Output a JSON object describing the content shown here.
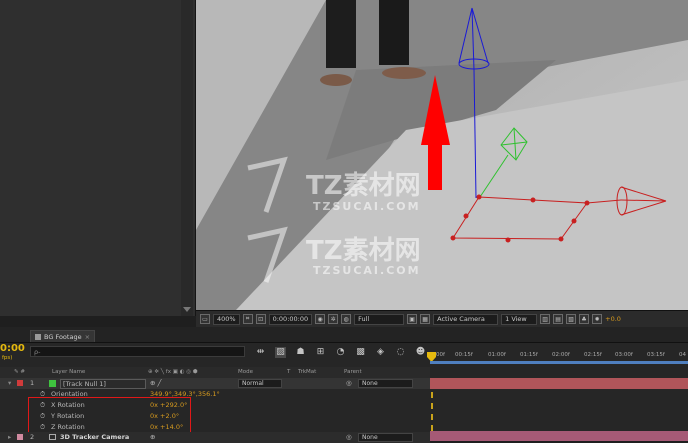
{
  "viewer": {
    "zoom": "400%",
    "timecode": "0:00:00:00",
    "resolution": "Full",
    "view": "Active Camera",
    "layout": "1 View",
    "exposure": "+0.0"
  },
  "watermark": {
    "brand": "TZ素材网",
    "url": "TZSUCAI.COM"
  },
  "timeline": {
    "tab_label": "BG Footage",
    "timecode": "0:00",
    "fps": "fps)",
    "search_placeholder": "ρ-",
    "columns": {
      "layer_name": "Layer Name",
      "switches": "⊕ ✲ ╲ fx ▣ ◐ ◎ ⬢",
      "mode": "Mode",
      "t": "T",
      "trkmat": "TrkMat",
      "parent": "Parent"
    },
    "ruler_ticks": [
      "00f",
      "00:15f",
      "01:00f",
      "01:15f",
      "02:00f",
      "02:15f",
      "03:00f",
      "03:15f",
      "04"
    ],
    "layers": [
      {
        "number": "1",
        "name": "[Track Null 1]",
        "mode": "Normal",
        "parent": "None",
        "color": "#3fc23f",
        "properties": [
          {
            "name": "Orientation",
            "value": "349.9°,349.3°,356.1°"
          },
          {
            "name": "X Rotation",
            "value": "0x +292.0°"
          },
          {
            "name": "Y Rotation",
            "value": "0x +2.0°"
          },
          {
            "name": "Z Rotation",
            "value": "0x +14.0°"
          }
        ]
      },
      {
        "number": "2",
        "name": "3D Tracker Camera",
        "parent": "None"
      }
    ]
  }
}
